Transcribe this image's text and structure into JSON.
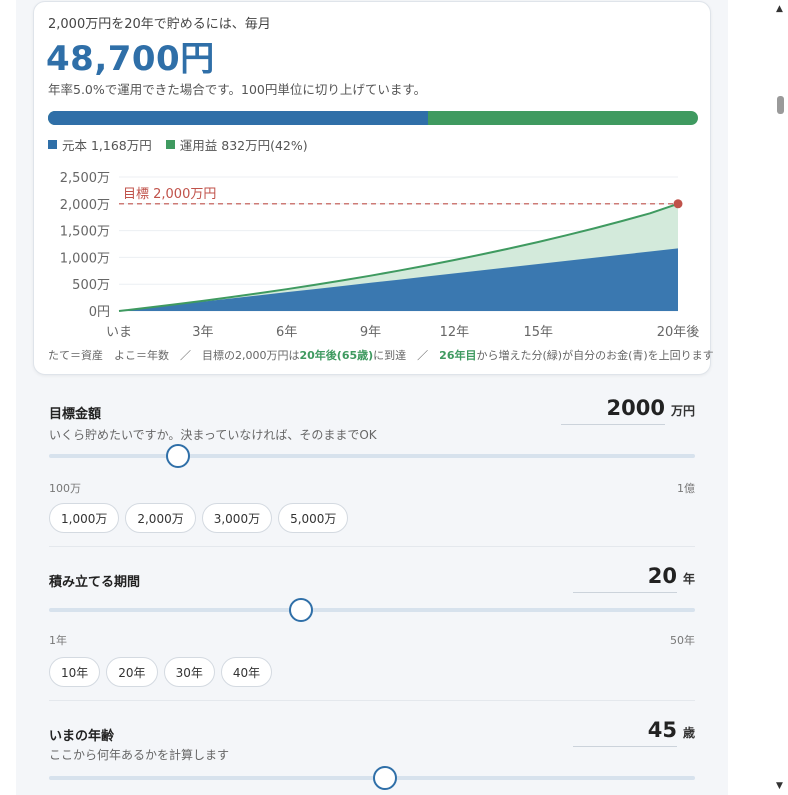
{
  "summary": {
    "headline": "2,000万円を20年で貯めるには、毎月",
    "amount": "48,700円",
    "note": "年率5.0%で運用できた場合です。100円単位に切り上げています。",
    "principal_fraction": 0.584,
    "legend_principal": "元本 1,168万円",
    "legend_gain": "運用益 832万円(42%)",
    "colors": {
      "principal": "#2f6fa8",
      "gain": "#3f9a60",
      "target": "#c0524a"
    }
  },
  "chart_data": {
    "type": "area",
    "x": [
      0,
      1,
      2,
      3,
      4,
      5,
      6,
      7,
      8,
      9,
      10,
      11,
      12,
      13,
      14,
      15,
      16,
      17,
      18,
      19,
      20
    ],
    "x_tick_labels": [
      "いま",
      "3年",
      "6年",
      "9年",
      "12年",
      "15年",
      "20年後"
    ],
    "x_tick_values": [
      0,
      3,
      6,
      9,
      12,
      15,
      20
    ],
    "xlim": [
      0,
      20
    ],
    "y_tick_labels": [
      "0円",
      "500万",
      "1,000万",
      "1,500万",
      "2,000万",
      "2,500万"
    ],
    "y_tick_values": [
      0,
      500,
      1000,
      1500,
      2000,
      2500
    ],
    "ylim": [
      0,
      2500
    ],
    "series": [
      {
        "name": "元本",
        "values": [
          0,
          58,
          117,
          175,
          234,
          292,
          351,
          409,
          467,
          526,
          584,
          643,
          701,
          760,
          818,
          876,
          935,
          993,
          1052,
          1110,
          1168
        ]
      },
      {
        "name": "運用益",
        "values": [
          0,
          60,
          123,
          189,
          258,
          331,
          407,
          487,
          571,
          659,
          752,
          849,
          951,
          1058,
          1170,
          1288,
          1412,
          1542,
          1679,
          1822,
          2000
        ]
      }
    ],
    "target": {
      "value": 2000,
      "label": "目標 2,000万円"
    },
    "grid": true,
    "caption_parts": [
      "たて＝資産　よこ＝年数　／　目標の2,000万円は",
      "20年後(65歳)",
      "に到達　／　",
      "26年目",
      "から増えた分(緑)が自分のお金(青)を上回ります"
    ]
  },
  "goal": {
    "title": "目標金額",
    "subtitle": "いくら貯めたいですか。決まっていなければ、そのままでOK",
    "value": "2000",
    "unit": "万円",
    "min_label": "100万",
    "max_label": "1億",
    "slider_fraction": 0.2,
    "presets": [
      "1,000万",
      "2,000万",
      "3,000万",
      "5,000万"
    ]
  },
  "period": {
    "title": "積み立てる期間",
    "value": "20",
    "unit": "年",
    "min_label": "1年",
    "max_label": "50年",
    "slider_fraction": 0.39,
    "presets": [
      "10年",
      "20年",
      "30年",
      "40年"
    ]
  },
  "age": {
    "title": "いまの年齢",
    "subtitle": "ここから何年あるかを計算します",
    "value": "45",
    "unit": "歳",
    "slider_fraction": 0.52
  }
}
